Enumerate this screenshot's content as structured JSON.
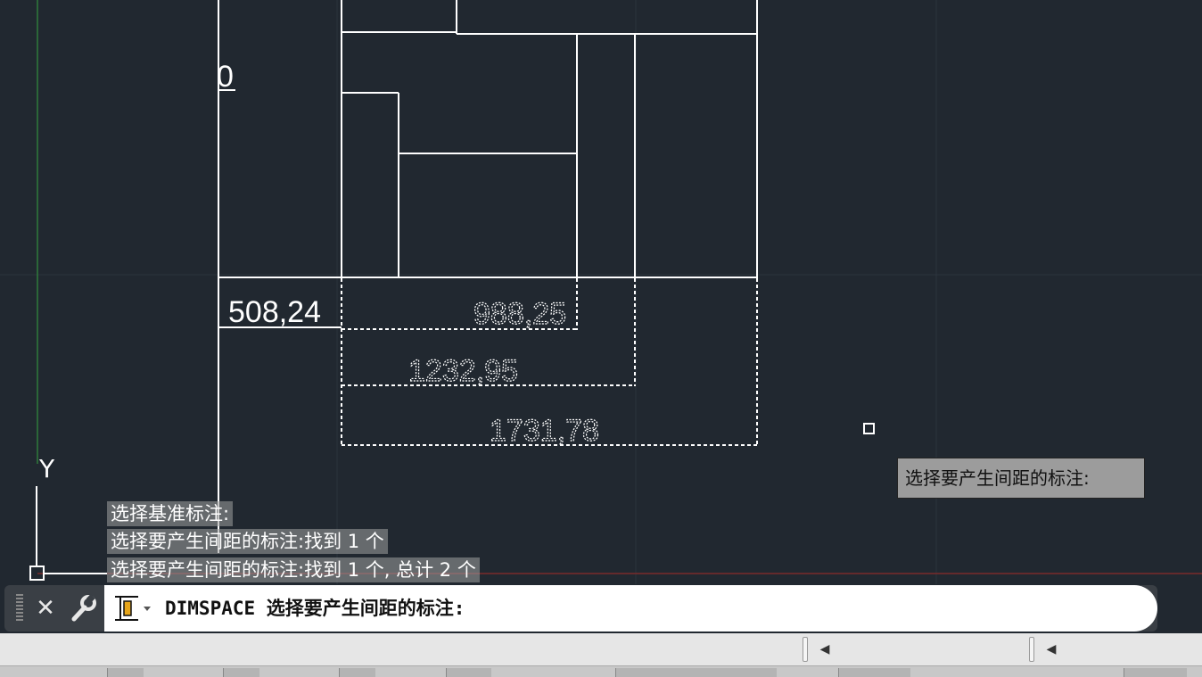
{
  "drawing": {
    "label_zero": "0",
    "dimensions": [
      {
        "text": "508,24"
      },
      {
        "text": "988,25"
      },
      {
        "text": "1232,95"
      },
      {
        "text": "1731,78"
      }
    ],
    "ucs_y_label": "Y"
  },
  "history": [
    "选择基准标注:",
    "选择要产生间距的标注:找到 1 个",
    "选择要产生间距的标注:找到 1 个, 总计 2 个"
  ],
  "tooltip": "选择要产生间距的标注:",
  "command_line": {
    "text": "DIMSPACE 选择要产生间距的标注:",
    "icons": [
      "grip-handle",
      "close-icon",
      "wrench-icon",
      "dimspace-icon"
    ]
  },
  "colors": {
    "background": "#212830",
    "grid": "#2e3640",
    "lines": "#ffffff",
    "axis_x": "#8a2f2f",
    "axis_y": "#2f7a3a"
  }
}
